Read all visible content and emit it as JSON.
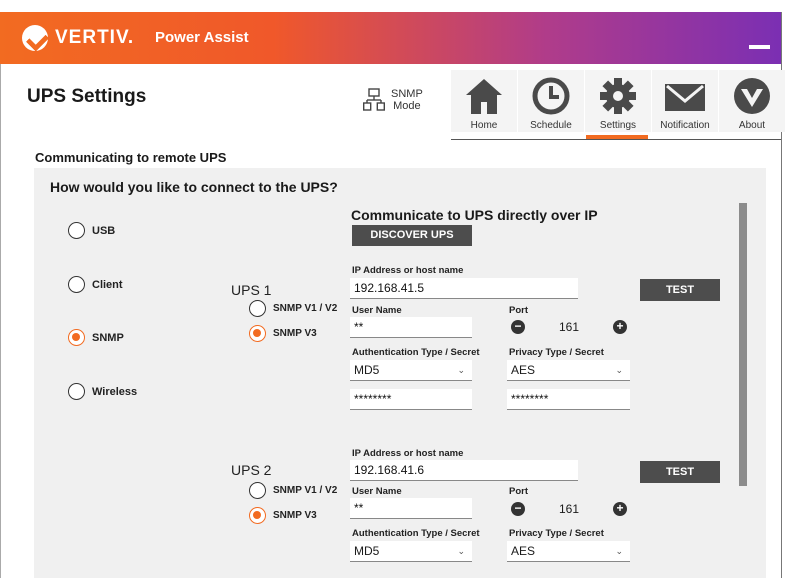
{
  "header": {
    "brand": "VERTIV.",
    "app_name": "Power Assist"
  },
  "page_title": "UPS Settings",
  "mode": {
    "line1": "SNMP",
    "line2": "Mode"
  },
  "tabs": [
    {
      "label": "Home",
      "icon": "home-icon"
    },
    {
      "label": "Schedule",
      "icon": "clock-icon"
    },
    {
      "label": "Settings",
      "icon": "gear-icon",
      "active": true
    },
    {
      "label": "Notification",
      "icon": "envelope-icon"
    },
    {
      "label": "About",
      "icon": "vertiv-logo-icon"
    }
  ],
  "section_title": "Communicating to remote UPS",
  "question": "How would you like to connect to the UPS?",
  "connection_options": [
    {
      "label": "USB",
      "selected": false
    },
    {
      "label": "Client",
      "selected": false
    },
    {
      "label": "SNMP",
      "selected": true
    },
    {
      "label": "Wireless",
      "selected": false
    }
  ],
  "direct_title": "Communicate to UPS directly over IP",
  "discover_label": "DISCOVER UPS",
  "labels": {
    "ip": "IP Address or host name",
    "user": "User Name",
    "port": "Port",
    "auth": "Authentication Type / Secret",
    "privacy": "Privacy Type / Secret",
    "test": "TEST",
    "snmp_v1v2": "SNMP V1 / V2",
    "snmp_v3": "SNMP V3"
  },
  "ups": [
    {
      "name": "UPS 1",
      "ip": "192.168.41.5",
      "user": "**",
      "port": "161",
      "version": "SNMP V3",
      "auth_type": "MD5",
      "auth_secret": "********",
      "privacy_type": "AES",
      "privacy_secret": "********"
    },
    {
      "name": "UPS 2",
      "ip": "192.168.41.6",
      "user": "**",
      "port": "161",
      "version": "SNMP V3",
      "auth_type": "MD5",
      "privacy_type": "AES"
    }
  ],
  "colors": {
    "accent": "#f26b21",
    "button": "#4d4d4d",
    "panel": "#f0f0f0"
  }
}
